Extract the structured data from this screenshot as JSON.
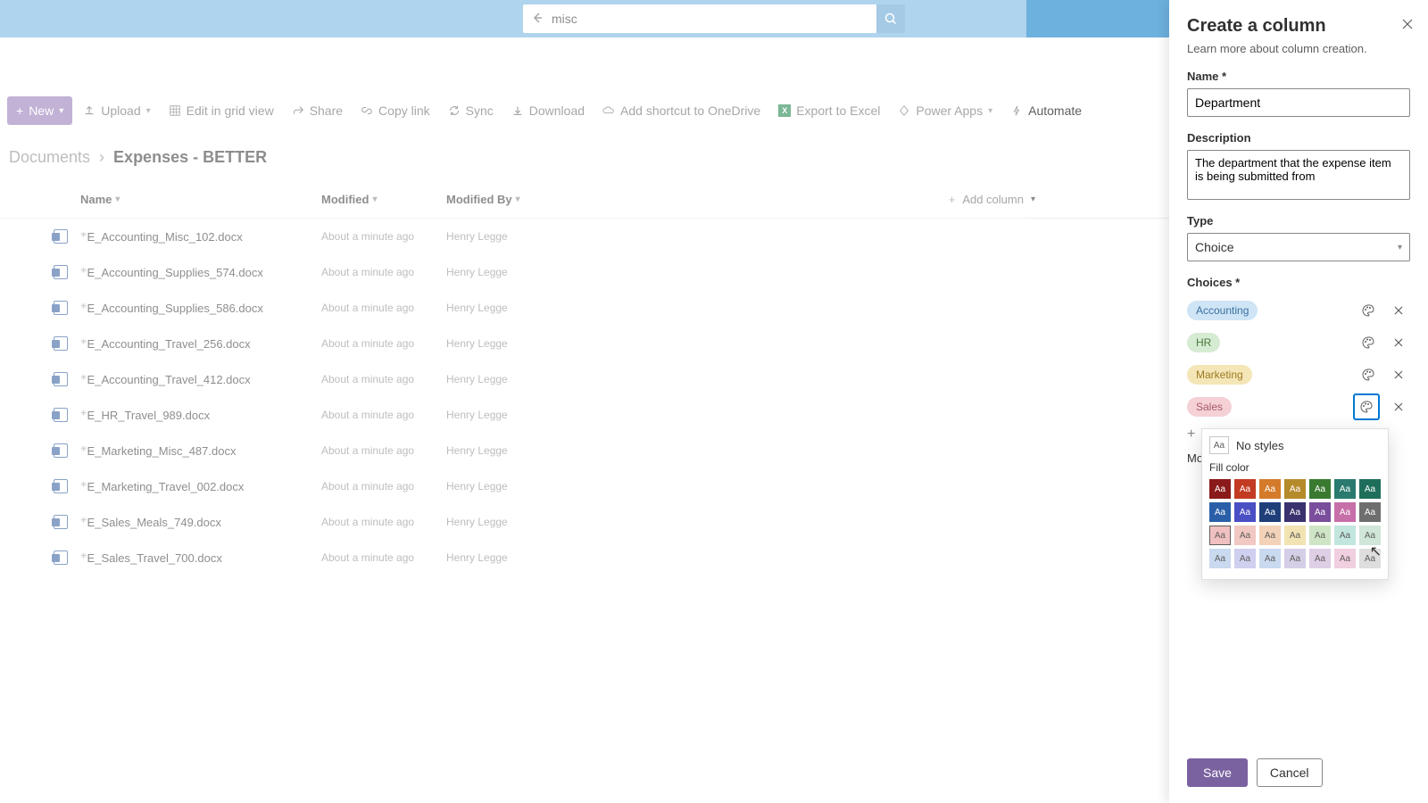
{
  "search": {
    "value": "misc"
  },
  "toolbar": {
    "new": "New",
    "upload": "Upload",
    "edit_grid": "Edit in grid view",
    "share": "Share",
    "copy_link": "Copy link",
    "sync": "Sync",
    "download": "Download",
    "shortcut": "Add shortcut to OneDrive",
    "excel": "Export to Excel",
    "power_apps": "Power Apps",
    "automate": "Automate"
  },
  "breadcrumb": {
    "root": "Documents",
    "current": "Expenses - BETTER"
  },
  "columns": {
    "name": "Name",
    "modified": "Modified",
    "modified_by": "Modified By",
    "add": "Add column"
  },
  "rows": [
    {
      "name": "E_Accounting_Misc_102.docx",
      "modified": "About a minute ago",
      "by": "Henry Legge"
    },
    {
      "name": "E_Accounting_Supplies_574.docx",
      "modified": "About a minute ago",
      "by": "Henry Legge"
    },
    {
      "name": "E_Accounting_Supplies_586.docx",
      "modified": "About a minute ago",
      "by": "Henry Legge"
    },
    {
      "name": "E_Accounting_Travel_256.docx",
      "modified": "About a minute ago",
      "by": "Henry Legge"
    },
    {
      "name": "E_Accounting_Travel_412.docx",
      "modified": "About a minute ago",
      "by": "Henry Legge"
    },
    {
      "name": "E_HR_Travel_989.docx",
      "modified": "About a minute ago",
      "by": "Henry Legge"
    },
    {
      "name": "E_Marketing_Misc_487.docx",
      "modified": "About a minute ago",
      "by": "Henry Legge"
    },
    {
      "name": "E_Marketing_Travel_002.docx",
      "modified": "About a minute ago",
      "by": "Henry Legge"
    },
    {
      "name": "E_Sales_Meals_749.docx",
      "modified": "About a minute ago",
      "by": "Henry Legge"
    },
    {
      "name": "E_Sales_Travel_700.docx",
      "modified": "About a minute ago",
      "by": "Henry Legge"
    }
  ],
  "panel": {
    "title": "Create a column",
    "sub": "Learn more about column creation.",
    "name_label": "Name *",
    "name_value": "Department",
    "desc_label": "Description",
    "desc_value": "The department that the expense item is being submitted from",
    "type_label": "Type",
    "type_value": "Choice",
    "choices_label": "Choices *",
    "choices": [
      {
        "label": "Accounting",
        "cls": "pill-blue"
      },
      {
        "label": "HR",
        "cls": "pill-green"
      },
      {
        "label": "Marketing",
        "cls": "pill-gold"
      },
      {
        "label": "Sales",
        "cls": "pill-pink"
      }
    ],
    "more": "More options",
    "save": "Save",
    "cancel": "Cancel"
  },
  "color_popup": {
    "no_styles": "No styles",
    "fill_color": "Fill color",
    "rows": [
      [
        "#8b1a1a",
        "#c23b22",
        "#d47a2b",
        "#b58a2b",
        "#3a7a30",
        "#2a7a6f",
        "#1f6e5c"
      ],
      [
        "#2a5fa8",
        "#4b4fc4",
        "#1f3f7a",
        "#3a326e",
        "#7a4e9c",
        "#c76fa8",
        "#6e6e6e"
      ],
      [
        "#f0c0c0",
        "#f2c8c2",
        "#f2d2b8",
        "#f2e3b2",
        "#cfe6c6",
        "#c2e6de",
        "#cfe6d8"
      ],
      [
        "#c9d9ef",
        "#cfd0ef",
        "#c9d9ef",
        "#d4cfe6",
        "#decfe6",
        "#efcfe0",
        "#dedede"
      ]
    ],
    "light_rows": [
      2,
      3
    ]
  }
}
